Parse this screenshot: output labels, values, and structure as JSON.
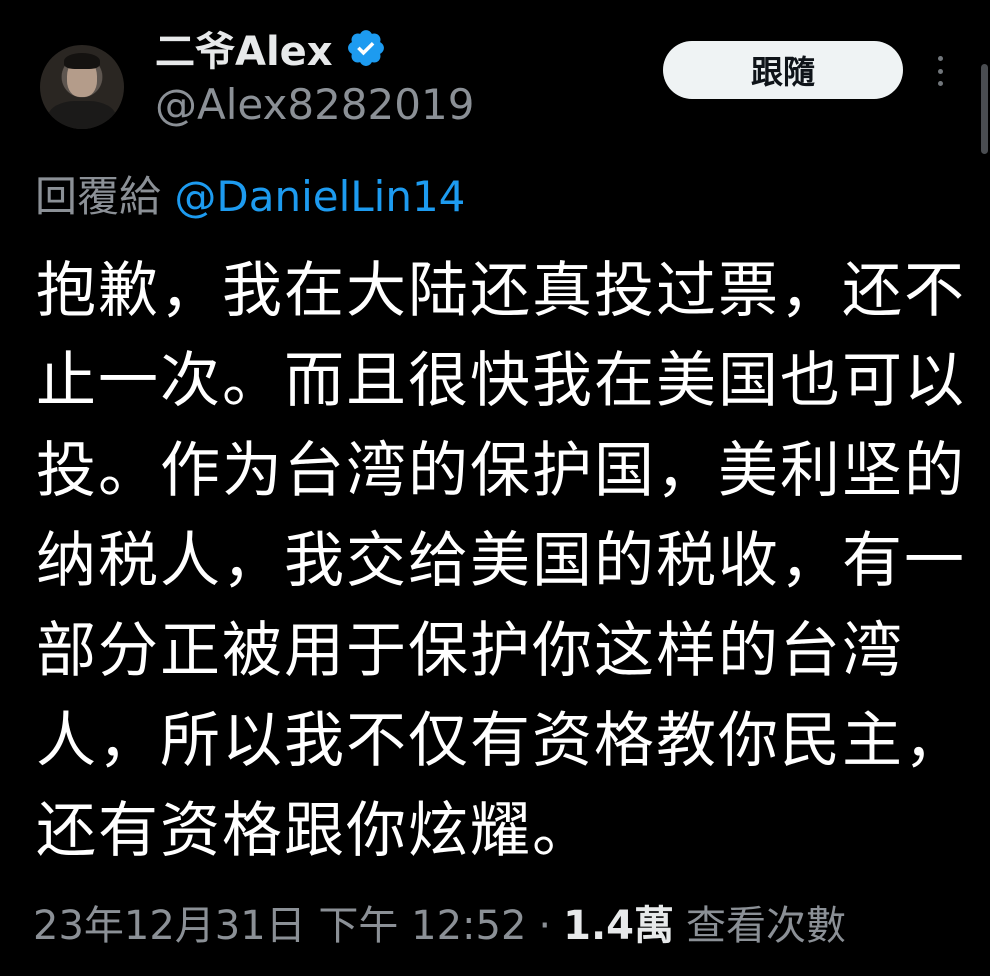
{
  "colors": {
    "background": "#000000",
    "text": "#e7e9ea",
    "muted": "#8b9096",
    "mention": "#1d9bf0",
    "verified": "#1d9bf0",
    "button_bg": "#eff3f4",
    "button_text": "#0f1419"
  },
  "author": {
    "display_name": "二爷Alex",
    "handle": "@Alex8282019",
    "verified_icon": "verified-badge-icon",
    "avatar_icon": "profile-photo"
  },
  "follow_button": {
    "label": "跟隨"
  },
  "more_icon": "more-vertical-icon",
  "reply": {
    "prefix": "回覆給",
    "mention": "@DanielLin14"
  },
  "body_lines": [
    "抱歉，我在大陆还真投过票，还不",
    "止一次。而且很快我在美国也可以",
    "投。作为台湾的保护国，美利坚的",
    "纳税人，我交给美国的税收，有一",
    "部分正被用于保护你这样的台湾",
    "人，所以我不仅有资格教你民主，",
    "还有资格跟你炫耀。"
  ],
  "meta": {
    "timestamp": "23年12月31日 下午 12:52",
    "separator": "·",
    "views_count": "1.4萬",
    "views_label": "查看次數"
  }
}
